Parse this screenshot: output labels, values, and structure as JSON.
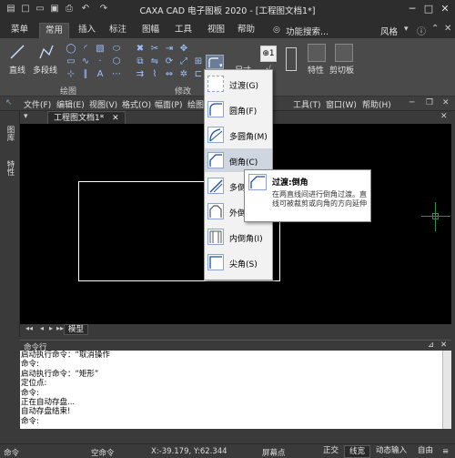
{
  "app": {
    "title": "CAXA CAD 电子图板 2020 - [工程图文档1*]",
    "style_label": "风格",
    "quick_access": [
      "file-icon",
      "new-icon",
      "open-icon",
      "save-icon",
      "print-icon",
      "undo-icon",
      "redo-icon"
    ]
  },
  "ribbon_tabs": [
    "菜单",
    "常用",
    "插入",
    "标注",
    "图幅",
    "工具",
    "视图",
    "帮助"
  ],
  "active_tab": "常用",
  "search_label": "功能搜索...",
  "ribbon": {
    "line_label": "直线",
    "polyline_label": "多段线",
    "draw_group": "绘图",
    "modify_group": "修改",
    "props_label": "特性",
    "clipboard_label": "剪切板",
    "dim_label": "尺寸"
  },
  "menubar": [
    "文件(F)",
    "编辑(E)",
    "视图(V)",
    "格式(O)",
    "幅面(P)",
    "绘图",
    "工具(T)",
    "窗口(W)",
    "帮助(H)"
  ],
  "doc_tab": "工程图文档1*",
  "left_panel": {
    "tab1": "图库",
    "tab2": "特性"
  },
  "layout_tab": "模型",
  "fillet_menu": {
    "items": [
      {
        "label": "过渡(G)",
        "icon": "transition-icon"
      },
      {
        "label": "圆角(F)",
        "icon": "fillet-icon"
      },
      {
        "label": "多圆角(M)",
        "icon": "multi-fillet-icon"
      },
      {
        "label": "倒角(C)",
        "icon": "chamfer-icon"
      },
      {
        "label": "多倒",
        "icon": "multi-chamfer-icon"
      },
      {
        "label": "外倒",
        "icon": "outer-chamfer-icon"
      },
      {
        "label": "内倒角(I)",
        "icon": "inner-chamfer-icon"
      },
      {
        "label": "尖角(S)",
        "icon": "sharp-corner-icon"
      }
    ],
    "highlighted_index": 3
  },
  "tooltip": {
    "title": "过渡:倒角",
    "description": "在两直线间进行倒角过渡。直线可被裁剪或向角的方向延伸"
  },
  "command": {
    "header": "命令行",
    "lines": [
      "启动执行命令：“取消操作",
      "命令:",
      "启动执行命令：“矩形”",
      "定位点:",
      "命令:",
      "正在自动存盘...",
      "自动存盘结束!",
      "命令:"
    ]
  },
  "statusbar": {
    "left": "命令",
    "command": "空命令",
    "coords": "X:-39.179, Y:62.344",
    "snap": "屏幕点",
    "buttons": [
      "正交",
      "线宽",
      "动态输入",
      "自由"
    ],
    "active_button": "线宽"
  },
  "colors": {
    "canvas": "#000000",
    "ribbon": "#4a4a4a",
    "crosshair": "#2e8b57",
    "highlight": "#cfd6e0"
  }
}
